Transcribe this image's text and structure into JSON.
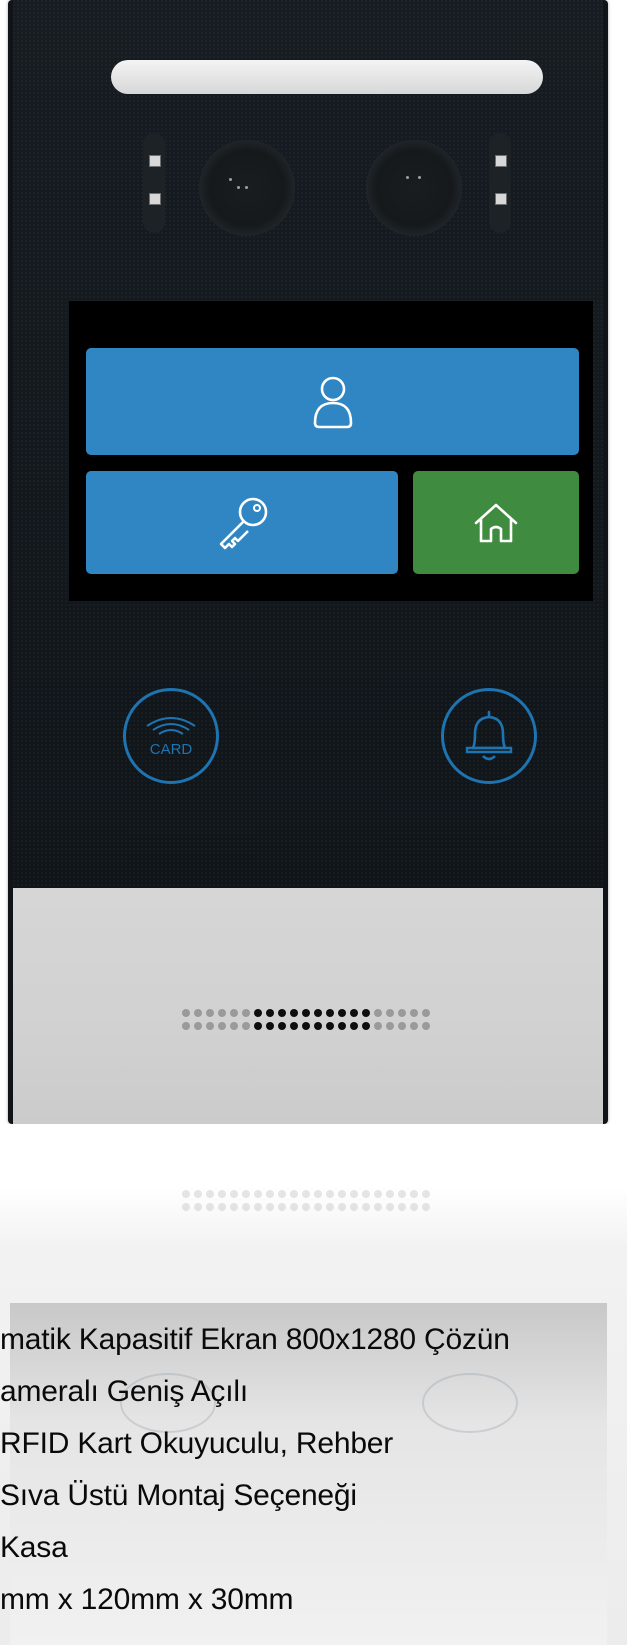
{
  "device": {
    "screen": {
      "tiles": [
        {
          "id": "contacts",
          "icon": "user-icon",
          "color": "#2f86c3"
        },
        {
          "id": "key",
          "icon": "key-icon",
          "color": "#2f86c3"
        },
        {
          "id": "home",
          "icon": "home-icon",
          "color": "#3f8b3f"
        }
      ]
    },
    "card_button": {
      "label": "CARD",
      "icon": "rfid-wave-icon",
      "color": "#1d74b0"
    },
    "bell_button": {
      "icon": "bell-icon",
      "color": "#1d74b0"
    }
  },
  "spec_lines": [
    "matik Kapasitif Ekran 800x1280 Çözün",
    "ameralı Geniş Açılı",
    "RFID Kart Okuyuculu, Rehber",
    "Sıva Üstü Montaj Seçeneği",
    " Kasa",
    "mm x 120mm x 30mm"
  ]
}
